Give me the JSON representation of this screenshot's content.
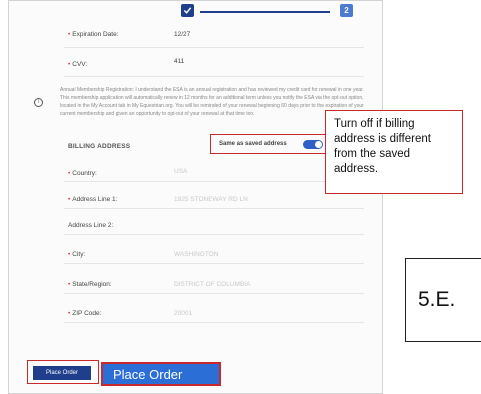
{
  "stepper": {
    "step2_label": "2"
  },
  "card": {
    "expiration_label": "Expiration Date:",
    "expiration_value": "12/27",
    "cvv_label": "CVV:",
    "cvv_value": "411"
  },
  "terms": {
    "text": "Annual Membership Registration: I understand the ESA is an annual registration and has reviewed my credit card for renewal in one year. This membership application will automatically renew in 12 months for an additional term unless you notify the ESA via the opt-out option, located in the My Account tab in My Equestrian.org. You will be reminded of your renewal beginning 60 days prior to the expiration of your current membership and given an opportunity to opt-out of your renewal at that time too."
  },
  "billing": {
    "title": "BILLING ADDRESS",
    "same_as_saved_label": "Same as saved address",
    "same_as_saved_on": true,
    "country_label": "Country:",
    "country_value": "USA",
    "address1_label": "Address Line 1:",
    "address1_value": "1925 STONEWAY RD LN",
    "address2_label": "Address Line 2:",
    "city_label": "City:",
    "city_value": "WASHINGTON",
    "state_label": "State/Region:",
    "state_value": "DISTRICT OF COLUMBIA",
    "zip_label": "ZIP Code:",
    "zip_value": "20001"
  },
  "callout": {
    "text": "Turn off if billing address is different from the saved address."
  },
  "step_tag": {
    "text": "5.E."
  },
  "actions": {
    "place_order_small": "Place Order",
    "place_order_large": "Place Order"
  },
  "colors": {
    "primary": "#1f3f8c",
    "accent": "#2b6ed6",
    "highlight_red": "#c9282d"
  }
}
